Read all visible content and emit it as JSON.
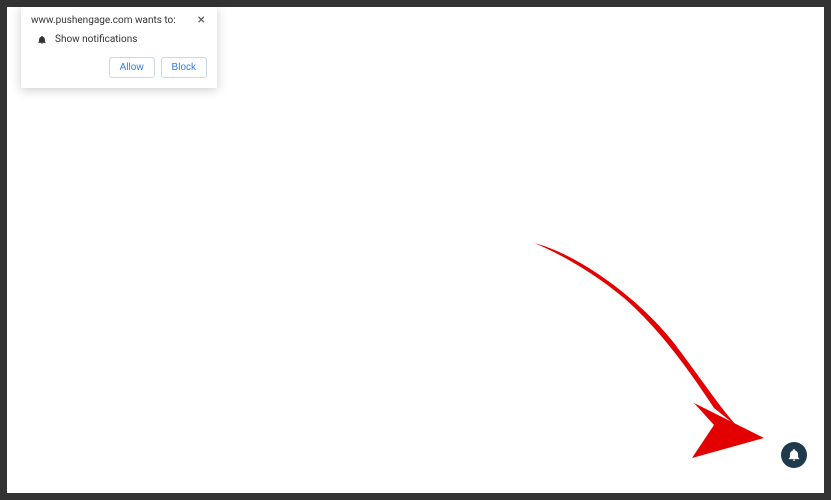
{
  "dialog": {
    "title": "www.pushengage.com wants to:",
    "body_text": "Show notifications",
    "allow_label": "Allow",
    "block_label": "Block"
  },
  "colors": {
    "arrow": "#e30000",
    "bell_bg": "#1f3a4d",
    "button_text": "#2b7de9"
  }
}
